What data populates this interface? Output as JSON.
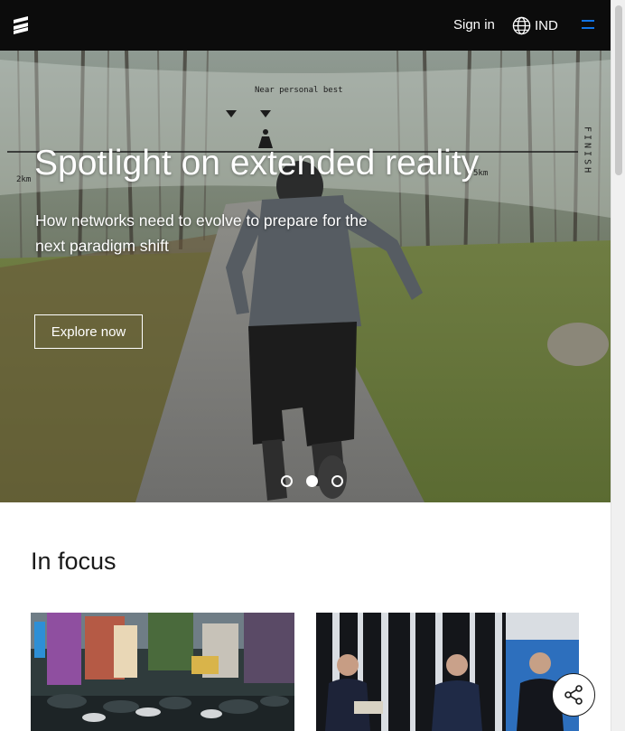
{
  "header": {
    "signin_label": "Sign in",
    "language_label": "IND",
    "logo_icon": "ericsson-logo-icon",
    "language_icon": "globe-icon",
    "menu_icon": "hamburger-menu-icon",
    "accent_color": "#1174e6",
    "background_color": "#0c0c0c"
  },
  "hero": {
    "title": "Spotlight on extended reality",
    "subtitle": "How networks need to evolve to prepare for the next paradigm shift",
    "cta_label": "Explore now",
    "overlay_labels": {
      "near_label": "Near personal best",
      "finish": "FINISH",
      "distance_start": "2km",
      "distance_end": "5km"
    },
    "carousel": {
      "slides": 3,
      "active_slide": 2
    }
  },
  "in_focus": {
    "title": "In focus",
    "cards": [
      {
        "image": "city-crowd-umbrellas-photo"
      },
      {
        "image": "panel-discussion-photo"
      }
    ]
  },
  "share": {
    "icon": "share-icon"
  }
}
